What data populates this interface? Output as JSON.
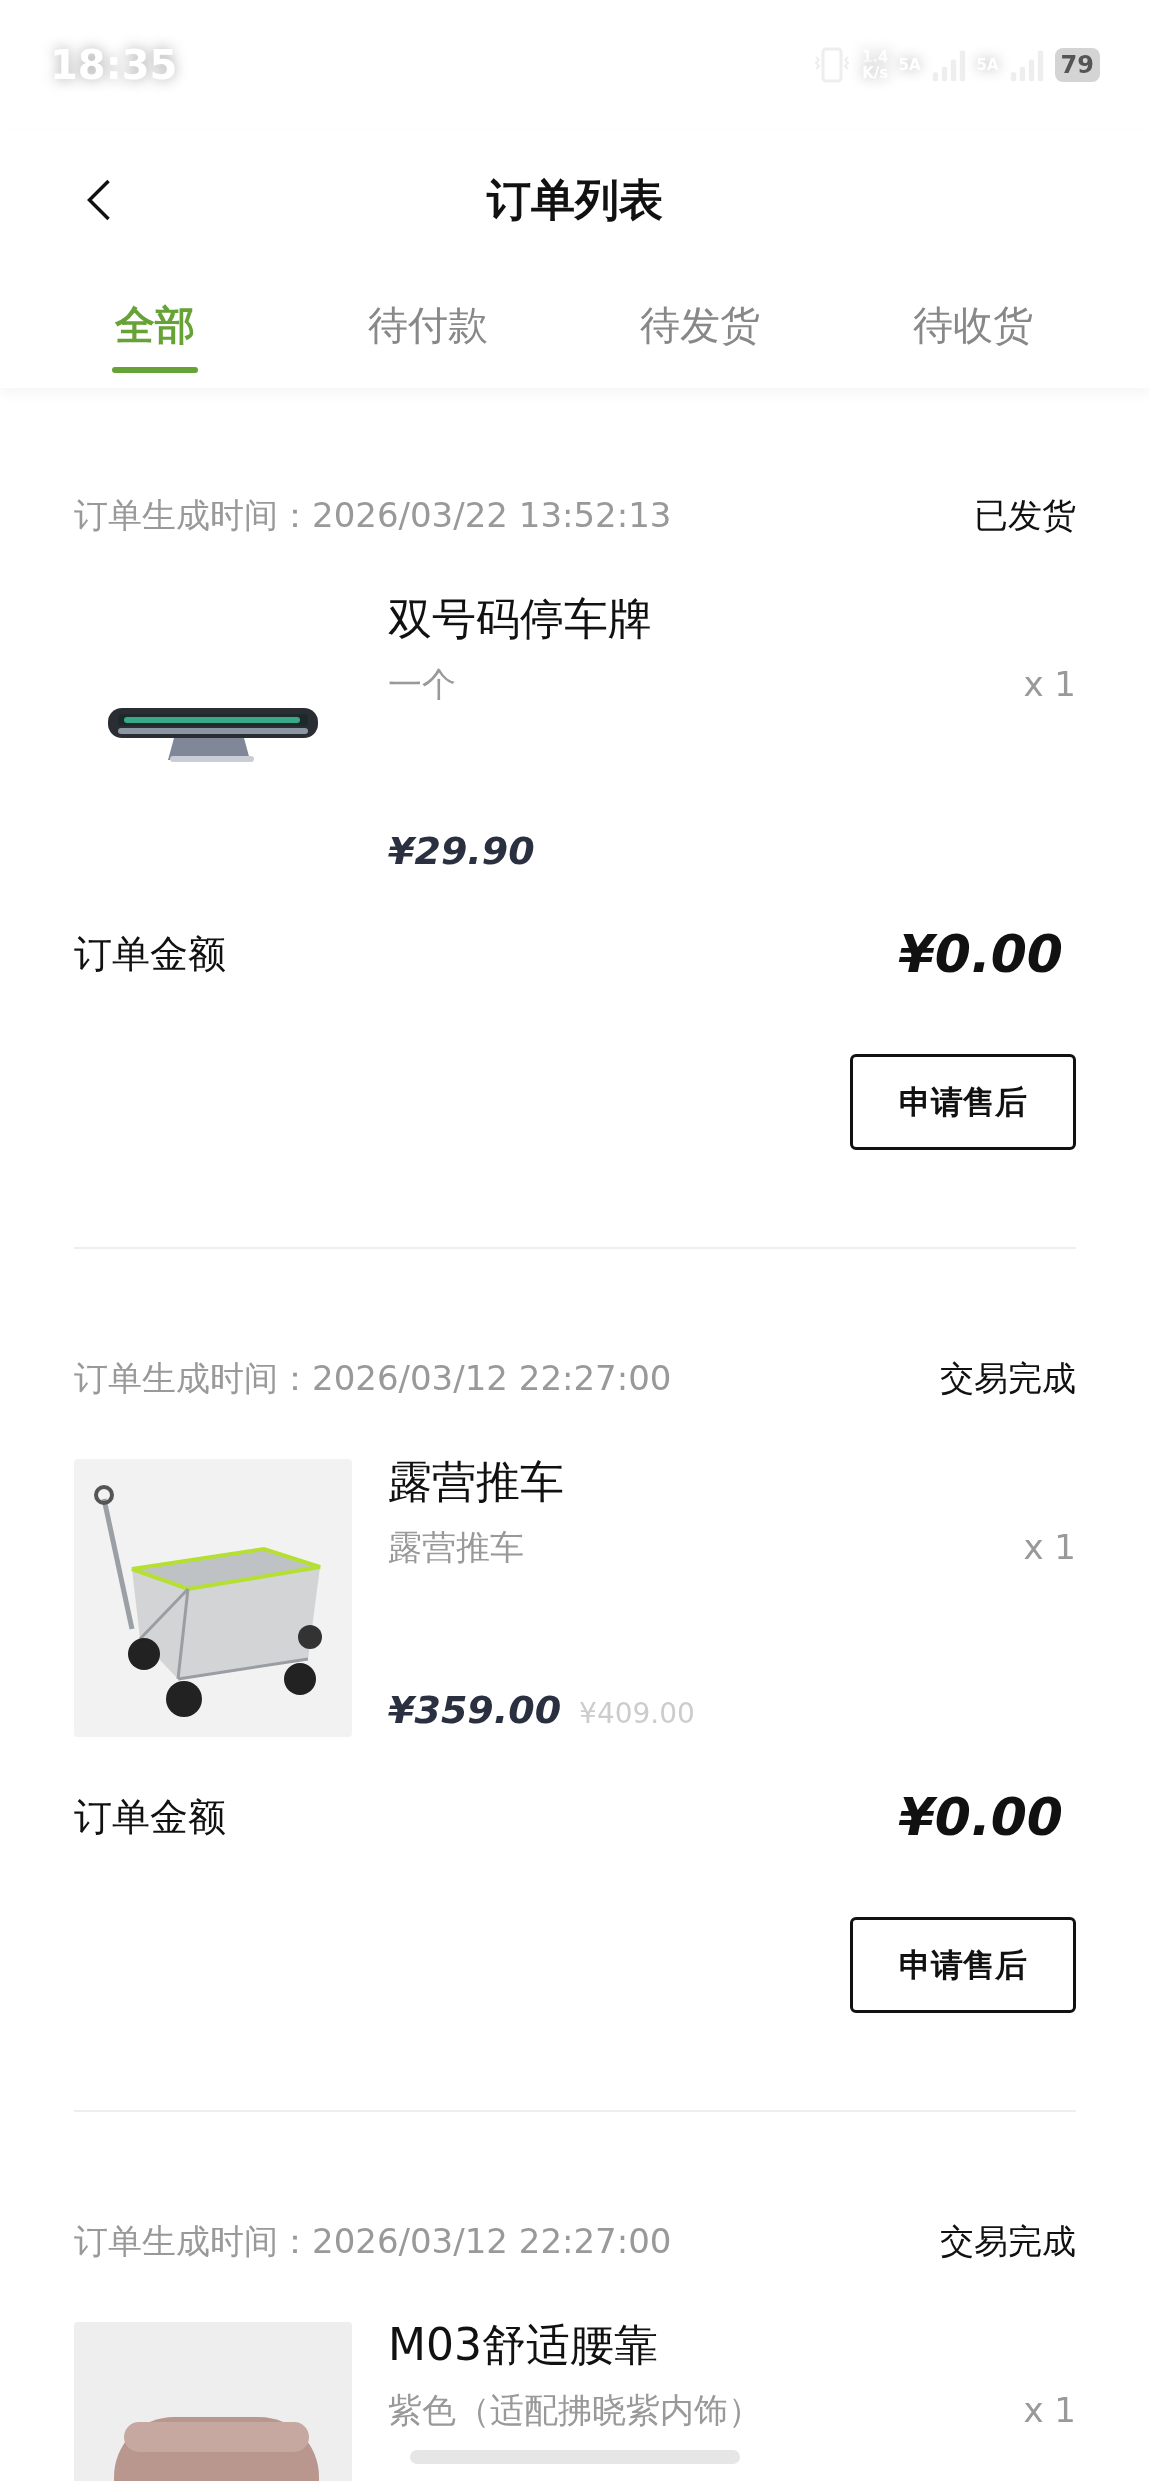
{
  "status_bar": {
    "time": "18:35",
    "speed_value": "1.4",
    "speed_unit": "K/s",
    "sim_1": "5A",
    "sim_2": "5A",
    "battery": "79"
  },
  "header": {
    "title": "订单列表"
  },
  "tabs": [
    {
      "label": "全部",
      "selected": true
    },
    {
      "label": "待付款",
      "selected": false
    },
    {
      "label": "待发货",
      "selected": false
    },
    {
      "label": "待收货",
      "selected": false
    }
  ],
  "orders": [
    {
      "created": "订单生成时间：2026/03/22 13:52:13",
      "status": "已发货",
      "product": {
        "kind": "plate",
        "name": "双号码停车牌",
        "spec": "一个",
        "quantity": "x 1",
        "price": "¥29.90"
      },
      "amount_label": "订单金额",
      "amount": "¥0.00",
      "action": "申请售后"
    },
    {
      "created": "订单生成时间：2026/03/12 22:27:00",
      "status": "交易完成",
      "product": {
        "kind": "cart",
        "name": "露营推车",
        "spec": "露营推车",
        "quantity": "x 1",
        "price": "¥359.00",
        "original_price": "¥409.00"
      },
      "amount_label": "订单金额",
      "amount": "¥0.00",
      "action": "申请售后"
    },
    {
      "created": "订单生成时间：2026/03/12 22:27:00",
      "status": "交易完成",
      "product": {
        "kind": "cushion",
        "name": "M03舒适腰靠",
        "spec": "紫色（适配拂晓紫内饰）",
        "quantity": "x 1"
      }
    }
  ]
}
